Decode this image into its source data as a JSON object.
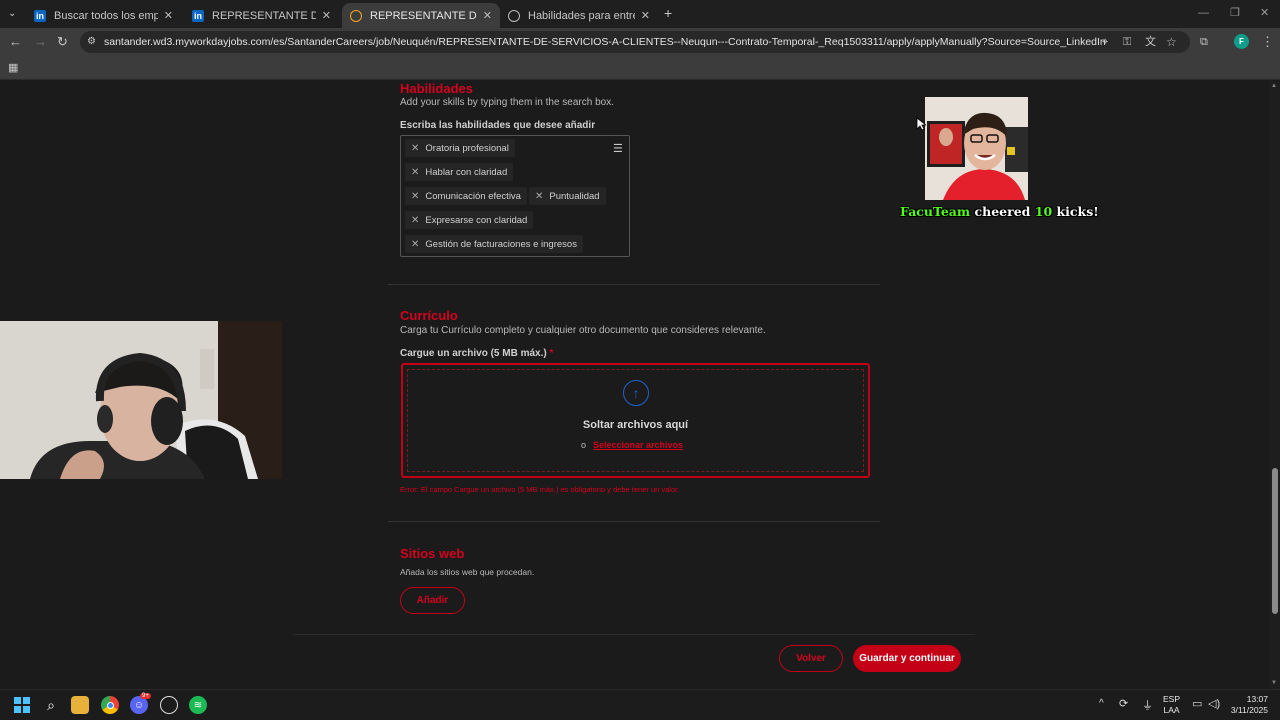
{
  "browser": {
    "tabs": [
      {
        "label": "Buscar todos los empleos | Link",
        "icon": "linkedin-icon",
        "active": false
      },
      {
        "label": "REPRESENTANTE DE SERVICIOS",
        "icon": "linkedin-icon",
        "active": false
      },
      {
        "label": "REPRESENTANTE DE SERVICIOS",
        "icon": "workday-icon",
        "active": true
      },
      {
        "label": "Habilidades para entrevista ba",
        "icon": "globe-icon",
        "active": false
      }
    ],
    "url": "santander.wd3.myworkdayjobs.com/es/SantanderCareers/job/Neuquén/REPRESENTANTE-DE-SERVICIOS-A-CLIENTES--Neuqun---Contrato-Temporal-_Req1503311/apply/applyManually?Source=Source_LinkedIn",
    "profile_initial": "F"
  },
  "skills": {
    "title": "Habilidades",
    "subtitle": "Add your skills by typing them in the search box.",
    "field_label": "Escriba las habilidades que desee añadir",
    "items": [
      "Oratoria profesional",
      "Hablar con claridad",
      "Comunicación efectiva",
      "Puntualidad",
      "Expresarse con claridad",
      "Gestión de facturaciones e ingresos"
    ]
  },
  "resume": {
    "title": "Currículo",
    "subtitle": "Carga tu Currículo completo y cualquier otro documento que consideres relevante.",
    "field_label": "Cargue un archivo (5 MB máx.)",
    "required_mark": "*",
    "drop_text": "Soltar archivos aquí",
    "or_text": "o",
    "select_link": "Seleccionar archivos",
    "error": "Error: El campo Cargue un archivo (5 MB máx.) es obligatorio y debe tener un valor."
  },
  "websites": {
    "title": "Sitios web",
    "subtitle": "Añada los sitios web que procedan.",
    "add_label": "Añadir"
  },
  "footer": {
    "back_label": "Volver",
    "save_label": "Guardar y continuar"
  },
  "overlay": {
    "cheer_user": "FacuTeam",
    "cheer_mid": "cheered",
    "cheer_count": "10",
    "cheer_end": "kicks!"
  },
  "taskbar": {
    "lang_top": "ESP",
    "lang_bottom": "LAA",
    "time": "13:07",
    "date": "3/11/2025",
    "discord_badge": "9+"
  },
  "colors": {
    "accent": "#c30016",
    "kick_green": "#53fc18"
  }
}
